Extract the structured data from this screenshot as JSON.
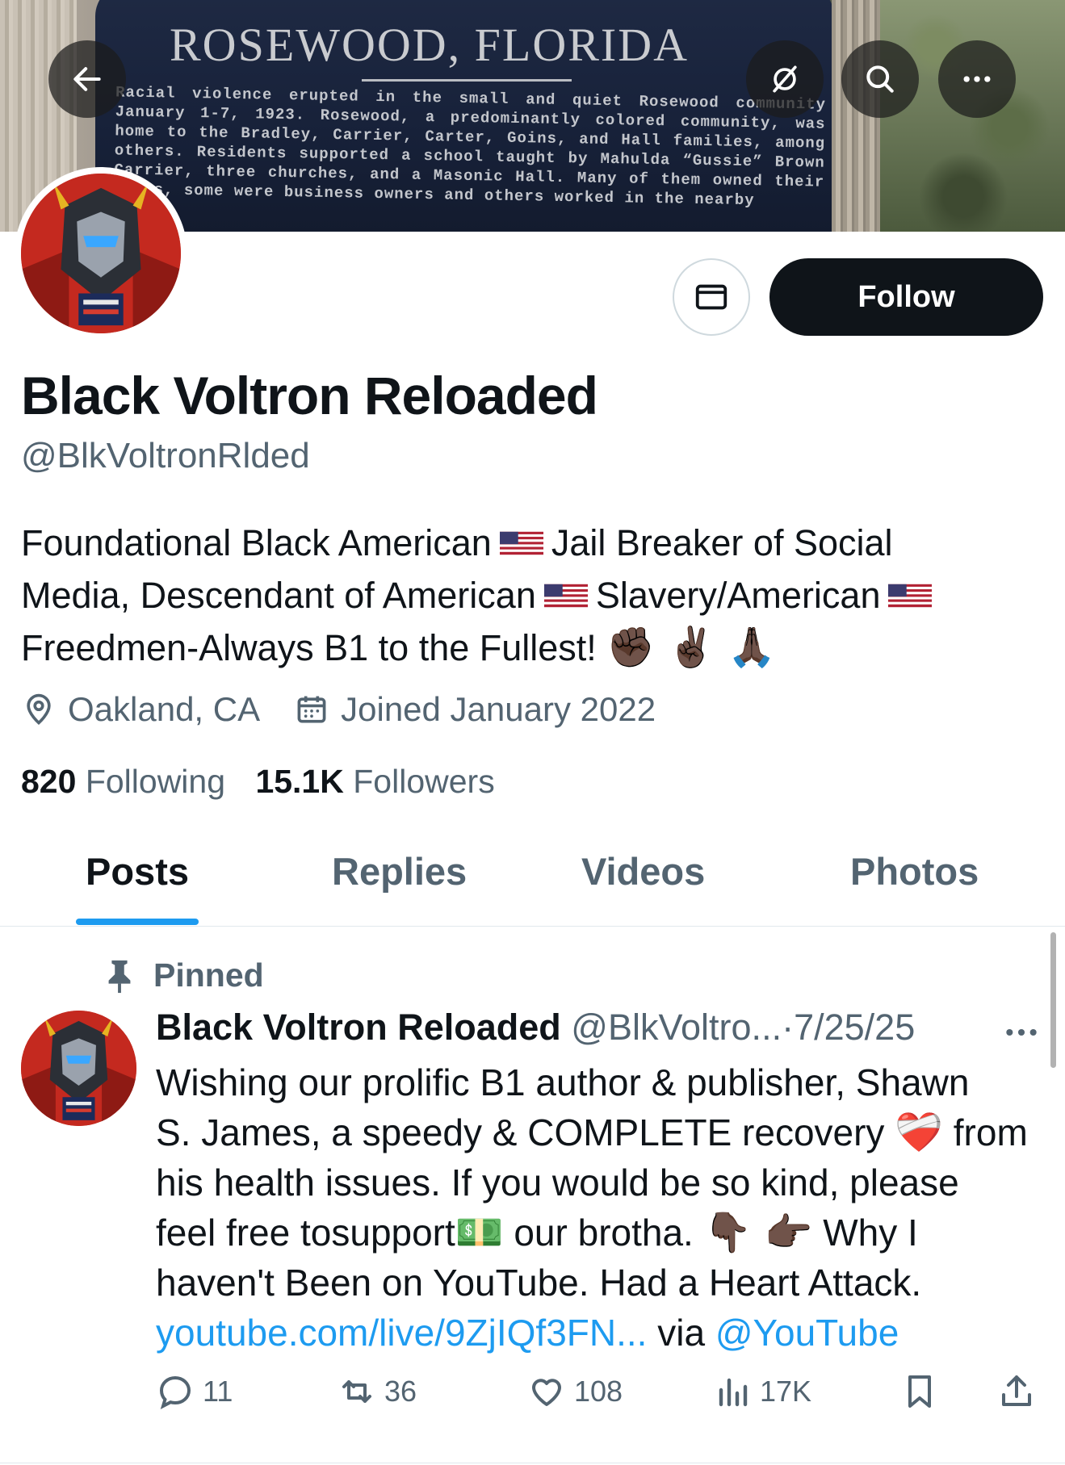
{
  "banner": {
    "sign_title": "ROSEWOOD, FLORIDA",
    "sign_text": "Racial violence erupted in the small and quiet Rosewood community January 1-7, 1923. Rosewood, a predominantly colored community, was home to the Bradley, Carrier, Carter, Goins, and Hall families, among others. Residents supported a school taught by Mahulda “Gussie” Brown Carrier, three churches, and a Masonic Hall. Many of them owned their homes, some were business owners and others worked in the nearby"
  },
  "top_nav": {
    "back_icon": "arrow-left-icon",
    "translate_icon": "translate-off-icon",
    "search_icon": "search-icon",
    "more_icon": "more-horizontal-icon"
  },
  "profile": {
    "name": "Black Voltron Reloaded",
    "handle": "@BlkVoltronRlded",
    "follow_label": "Follow",
    "message_icon": "envelope-icon",
    "bio": {
      "line1_a": "Foundational Black American",
      "line1_b": "Jail Breaker of Social",
      "line2_a": "Media, Descendant of American",
      "line2_b": "Slavery/American",
      "line3_a": "Freedmen-Always B1 to the Fullest!",
      "line3_emojis": "✊🏿 ✌🏿 🙏🏿"
    },
    "location": "Oakland, CA",
    "joined": "Joined January 2022",
    "following_count": "820",
    "following_label": "Following",
    "followers_count": "15.1K",
    "followers_label": "Followers"
  },
  "tabs": [
    {
      "label": "Posts",
      "active": true
    },
    {
      "label": "Replies",
      "active": false
    },
    {
      "label": "Videos",
      "active": false
    },
    {
      "label": "Photos",
      "active": false
    }
  ],
  "post": {
    "pinned_label": "Pinned",
    "author_name": "Black Voltron Reloaded",
    "author_handle": "@BlkVoltro...",
    "separator": "·",
    "date": "7/25/25",
    "line1": "Wishing our prolific B1 author & publisher, Shawn",
    "line2_a": "S. James, a speedy & COMPLETE recovery",
    "line2_emoji": "❤️‍🩹",
    "line2_b": "from",
    "line3": "his health issues. If you would be so kind, please",
    "line4_a": "feel free tosupport",
    "line4_emoji": "💵",
    "line4_b": "our brotha.",
    "line4_emojis": "👇🏿 👉🏿",
    "line4_c": "Why I",
    "line5": "haven't Been on YouTube. Had a Heart Attack.",
    "link": "youtube.com/live/9ZjIQf3FN...",
    "via": "via",
    "mention": "@YouTube",
    "stats": {
      "replies": "11",
      "reposts": "36",
      "likes": "108",
      "views": "17K"
    }
  },
  "colors": {
    "accent": "#1d9bf0",
    "text_primary": "#0f1419",
    "text_secondary": "#536471",
    "follow_bg": "#0f1419"
  }
}
